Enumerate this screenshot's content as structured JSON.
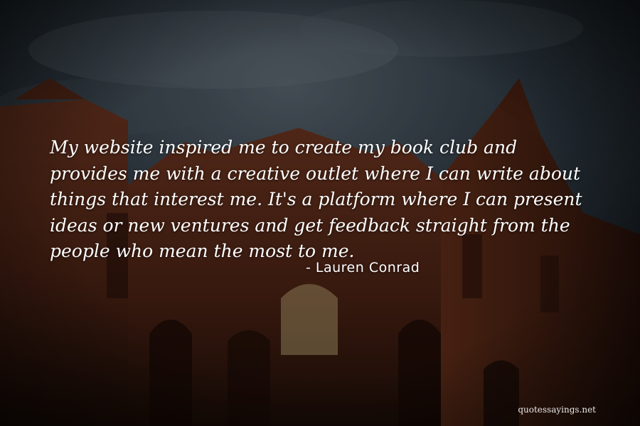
{
  "quote": {
    "lines": [
      "My website inspired me to create my book club and",
      "provides me with a creative outlet where I can write about",
      "things that interest me. It's a platform where I can present",
      "ideas or new ventures and get feedback straight from the",
      "people who mean the most to me."
    ],
    "author": "- Lauren Conrad"
  },
  "watermark": "quotessayings.net",
  "colors": {
    "text": "#ffffff",
    "sky": "#2a3640",
    "brick": "#5a2a1a"
  }
}
